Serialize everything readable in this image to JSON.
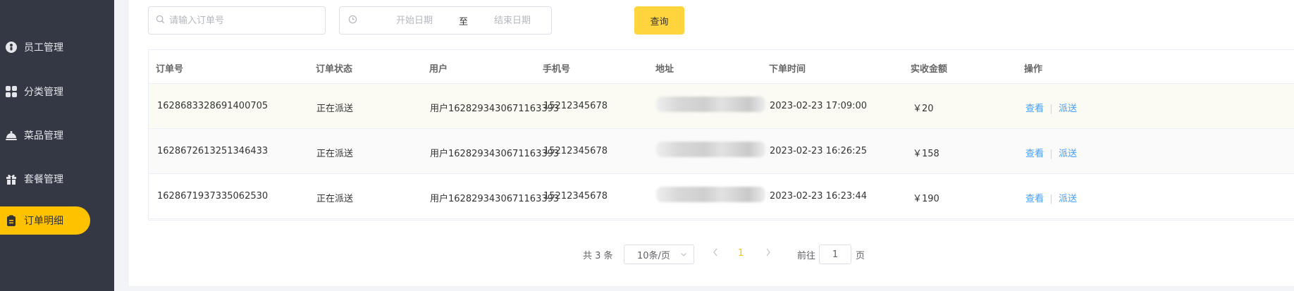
{
  "sidebar": {
    "items": [
      {
        "label": "员工管理",
        "icon": "employee-icon"
      },
      {
        "label": "分类管理",
        "icon": "category-icon"
      },
      {
        "label": "菜品管理",
        "icon": "dish-icon"
      },
      {
        "label": "套餐管理",
        "icon": "gift-icon"
      },
      {
        "label": "订单明细",
        "icon": "clipboard-icon",
        "active": true
      }
    ]
  },
  "search": {
    "order_placeholder": "请输入订单号",
    "start_placeholder": "开始日期",
    "range_separator": "至",
    "end_placeholder": "结束日期",
    "query_label": "查询"
  },
  "table": {
    "headers": [
      "订单号",
      "订单状态",
      "用户",
      "手机号",
      "地址",
      "下单时间",
      "实收金额",
      "操作"
    ],
    "rows": [
      {
        "order_no": "1628683328691400705",
        "status": "正在派送",
        "user": "用户1628293430671163393",
        "phone": "15212345678",
        "time": "2023-02-23 17:09:00",
        "amount": "￥20",
        "view": "查看",
        "dispatch": "派送"
      },
      {
        "order_no": "1628672613251346433",
        "status": "正在派送",
        "user": "用户1628293430671163393",
        "phone": "15212345678",
        "time": "2023-02-23 16:26:25",
        "amount": "￥158",
        "view": "查看",
        "dispatch": "派送"
      },
      {
        "order_no": "1628671937335062530",
        "status": "正在派送",
        "user": "用户1628293430671163393",
        "phone": "15212345678",
        "time": "2023-02-23 16:23:44",
        "amount": "￥190",
        "view": "查看",
        "dispatch": "派送"
      }
    ]
  },
  "pagination": {
    "total_text": "共 3 条",
    "page_size": "10条/页",
    "current_page": "1",
    "goto_label": "前往",
    "goto_value": "1",
    "page_suffix": "页"
  },
  "colors": {
    "sidebar_bg": "#343744",
    "accent": "#ffc200",
    "button": "#ffd43d",
    "link": "#409eff"
  }
}
